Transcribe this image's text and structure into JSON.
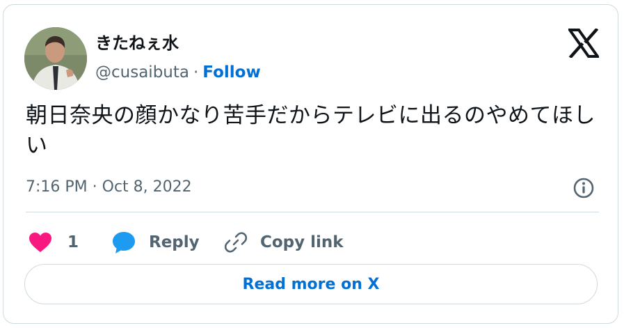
{
  "author": {
    "display_name": "きたねぇ水",
    "handle": "@cusaibuta",
    "separator": "·",
    "follow_label": "Follow"
  },
  "tweet": {
    "text": "朝日奈央の顔かなり苦手だからテレビに出るのやめてほしい",
    "timestamp": "7:16 PM · Oct 8, 2022"
  },
  "actions": {
    "like_count": "1",
    "reply_label": "Reply",
    "copy_link_label": "Copy link"
  },
  "read_more_label": "Read more on X",
  "colors": {
    "text_primary": "#0f1419",
    "text_secondary": "#536471",
    "link_blue": "#006fd6",
    "like_pink": "#f91880",
    "reply_blue": "#1d9bf0",
    "border": "#cfd9de"
  },
  "icons": {
    "logo": "x-logo-icon",
    "info": "info-icon",
    "like": "heart-icon",
    "reply": "speech-bubble-icon",
    "copy": "link-icon"
  }
}
